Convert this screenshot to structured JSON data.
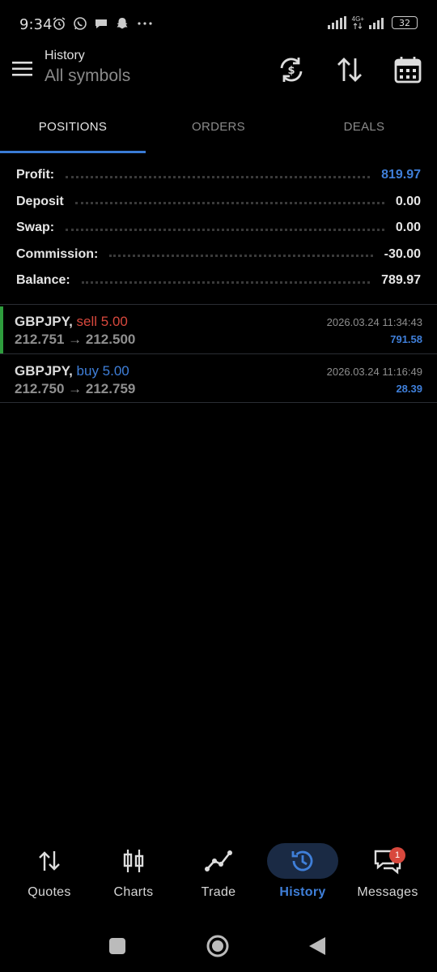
{
  "status_bar": {
    "time": "9:34",
    "network_label": "4G+",
    "battery": "32"
  },
  "header": {
    "title": "History",
    "subtitle": "All symbols",
    "icons": [
      "menu-icon",
      "sync-currency-icon",
      "sort-icon",
      "calendar-icon"
    ]
  },
  "tabs": [
    {
      "label": "POSITIONS",
      "active": true
    },
    {
      "label": "ORDERS",
      "active": false
    },
    {
      "label": "DEALS",
      "active": false
    }
  ],
  "summary": [
    {
      "label": "Profit:",
      "value": "819.97",
      "color": "#3f7fd9"
    },
    {
      "label": "Deposit",
      "value": "0.00"
    },
    {
      "label": "Swap:",
      "value": "0.00"
    },
    {
      "label": "Commission:",
      "value": "-30.00"
    },
    {
      "label": "Balance:",
      "value": "789.97"
    }
  ],
  "positions": [
    {
      "symbol": "GBPJPY,",
      "side": "sell 5.00",
      "side_type": "sell",
      "prices": "212.751 → 212.500",
      "time": "2026.03.24 11:34:43",
      "profit": "791.58",
      "highlighted": true
    },
    {
      "symbol": "GBPJPY,",
      "side": "buy 5.00",
      "side_type": "buy",
      "prices": "212.750 → 212.759",
      "time": "2026.03.24 11:16:49",
      "profit": "28.39",
      "highlighted": false
    }
  ],
  "bottom_nav": {
    "items": [
      {
        "label": "Quotes",
        "icon": "quotes-icon"
      },
      {
        "label": "Charts",
        "icon": "charts-icon"
      },
      {
        "label": "Trade",
        "icon": "trade-icon"
      },
      {
        "label": "History",
        "icon": "history-icon",
        "active": true
      },
      {
        "label": "Messages",
        "icon": "messages-icon",
        "badge": "1"
      }
    ]
  },
  "colors": {
    "accent": "#3f7fd9",
    "sell": "#d8483d",
    "buy": "#3f7fd9",
    "positive_bar": "#2e9d3d"
  }
}
